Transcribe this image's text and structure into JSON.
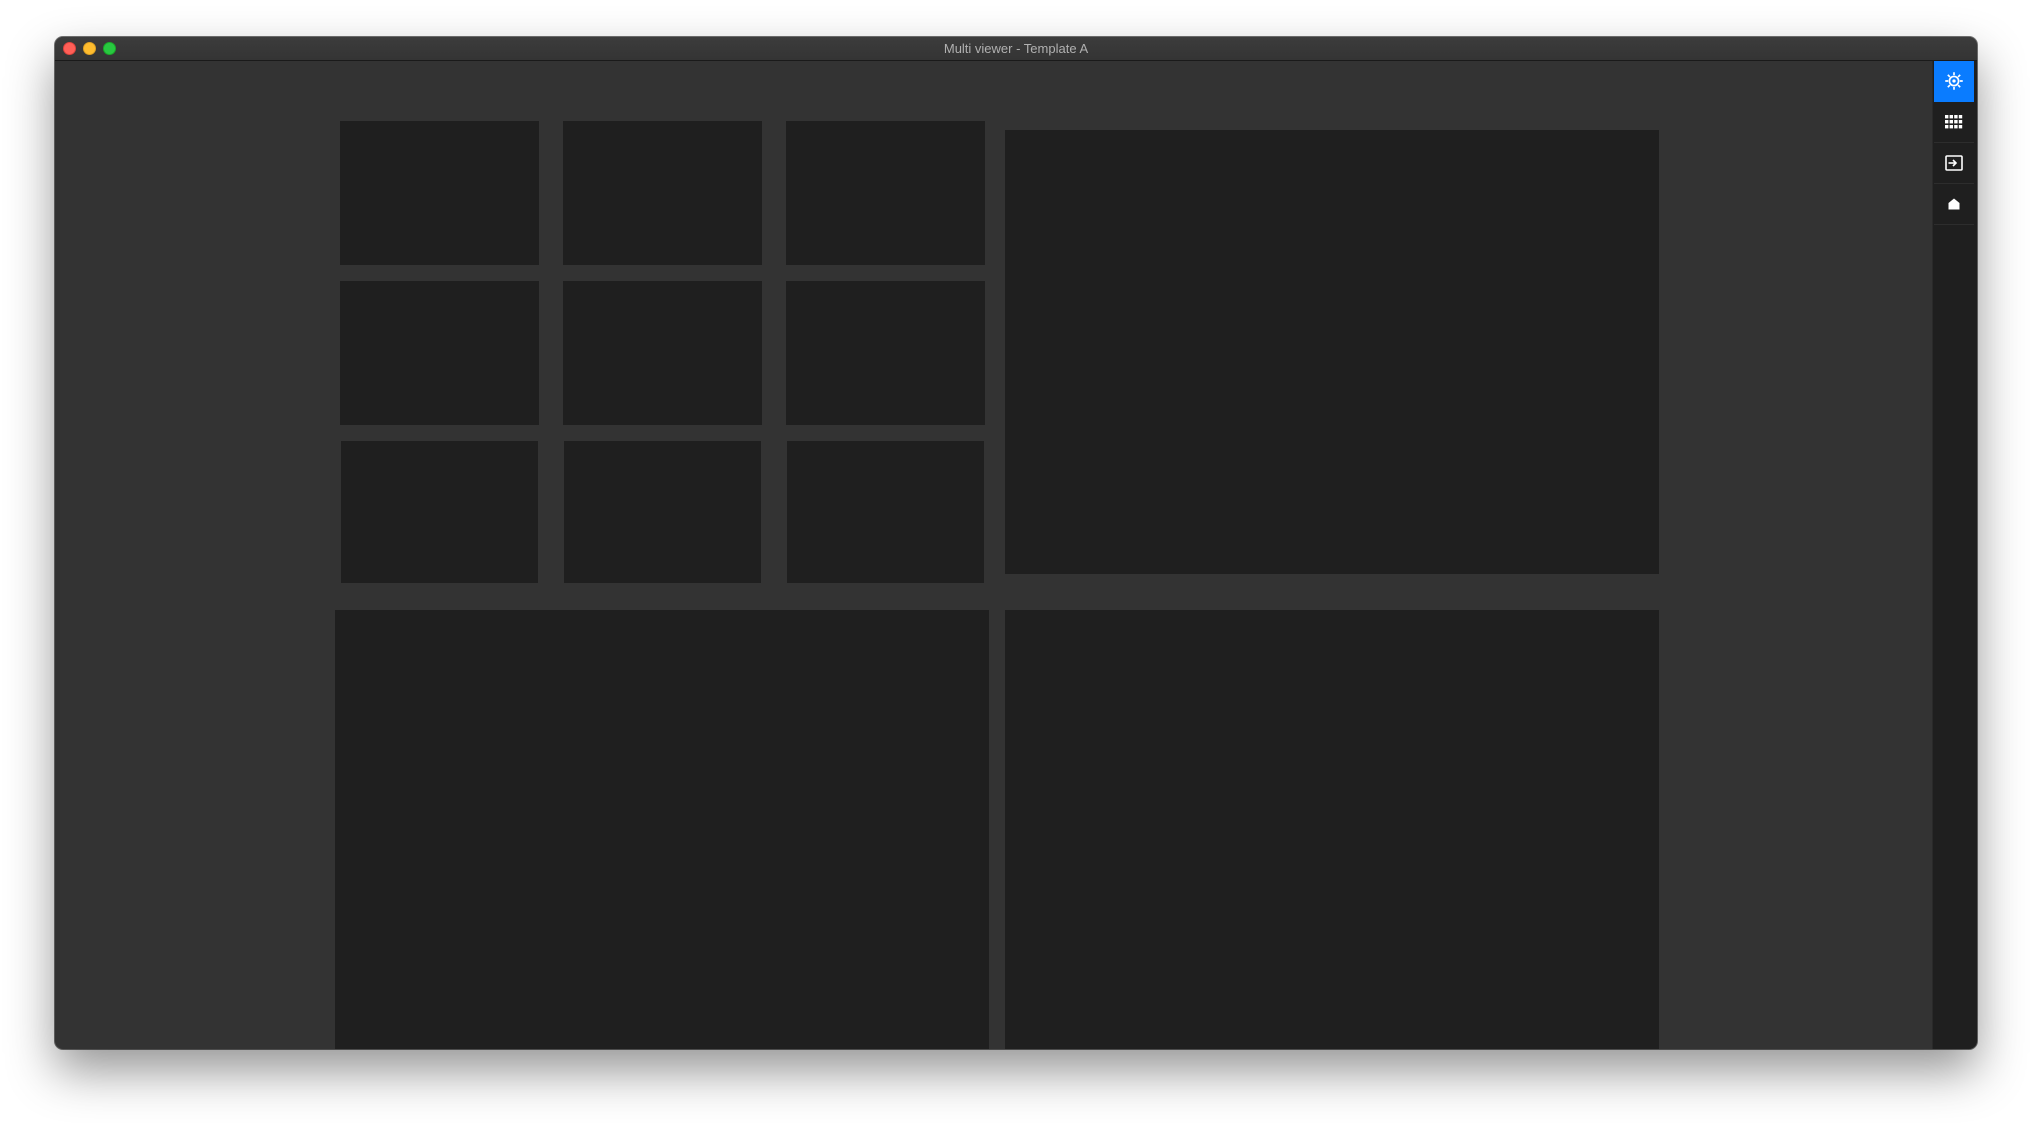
{
  "window": {
    "title": "Multi viewer - Template A"
  },
  "colors": {
    "background": "#333333",
    "tile": "#1f1f1f",
    "accent": "#0a7cff"
  },
  "sidebar": {
    "items": [
      {
        "icon": "gear-icon",
        "active": true
      },
      {
        "icon": "grid-icon",
        "active": false
      },
      {
        "icon": "input-icon",
        "active": false
      },
      {
        "icon": "home-icon",
        "active": false
      }
    ]
  }
}
